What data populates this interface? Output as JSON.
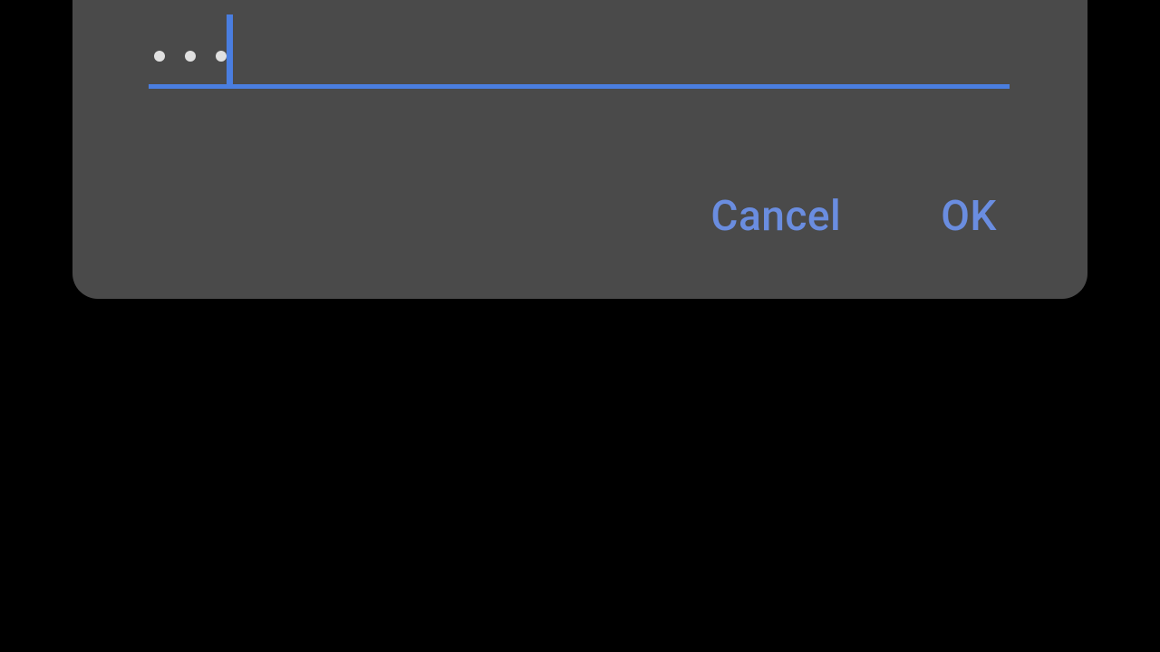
{
  "dialog": {
    "input": {
      "masked_value": "•••",
      "char_count": 3
    },
    "buttons": {
      "cancel": "Cancel",
      "ok": "OK"
    },
    "colors": {
      "accent": "#4a7ee0",
      "dialog_bg": "#4a4a4a",
      "button_text": "#6a8de0"
    }
  }
}
